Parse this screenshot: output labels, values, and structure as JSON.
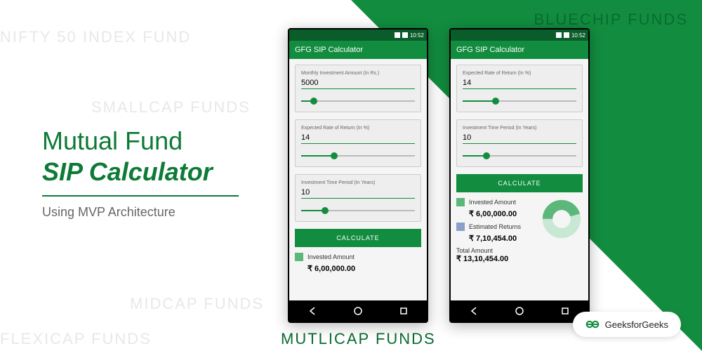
{
  "bg_words": {
    "w1": "NIFTY 50 INDEX FUND",
    "w2": "SMALLCAP FUNDS",
    "w3": "MIDCAP FUNDS",
    "w4": "FLEXICAP FUNDS",
    "w5": "BLUECHIP FUNDS",
    "w6": "MUTLICAP FUNDS"
  },
  "title": {
    "line1": "Mutual Fund",
    "line2": "SIP Calculator",
    "subtitle": "Using MVP Architecture"
  },
  "status": {
    "time": "10:52"
  },
  "app": {
    "title": "GFG SIP Calculator"
  },
  "fields": {
    "monthly": {
      "label": "Monthly Investment Amount (In Rs.)",
      "value": "5000"
    },
    "rate": {
      "label": "Expected Rate of Return (In %)",
      "value": "14"
    },
    "period": {
      "label": "Investment Time Period (In Years)",
      "value": "10"
    }
  },
  "button": {
    "calculate": "CALCULATE"
  },
  "results": {
    "invested_label": "Invested Amount",
    "invested_value": "₹ 6,00,000.00",
    "returns_label": "Estimated Returns",
    "returns_value": "₹ 7,10,454.00",
    "total_label": "Total Amount",
    "total_value": "₹ 13,10,454.00"
  },
  "brand": {
    "name": "GeeksforGeeks"
  }
}
